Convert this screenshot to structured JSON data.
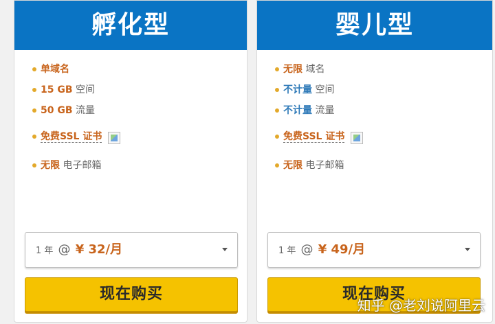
{
  "plans": [
    {
      "title": "孵化型",
      "features": {
        "domain": {
          "em": "单域名",
          "rest": ""
        },
        "space": {
          "em": "15 GB",
          "rest": "空间"
        },
        "traffic": {
          "em": "50 GB",
          "rest": "流量"
        },
        "ssl": {
          "em": "免费SSL 证书"
        },
        "email": {
          "em": "无限",
          "rest": "电子邮箱"
        }
      },
      "select": {
        "term": "1 年",
        "at": "@",
        "price": "¥ 32/月"
      },
      "buy_label": "现在购买"
    },
    {
      "title": "婴儿型",
      "features": {
        "domain": {
          "em": "无限",
          "rest": "域名"
        },
        "space": {
          "em": "不计量",
          "rest": "空间"
        },
        "traffic": {
          "em": "不计量",
          "rest": "流量"
        },
        "ssl": {
          "em": "免费SSL 证书"
        },
        "email": {
          "em": "无限",
          "rest": "电子邮箱"
        }
      },
      "select": {
        "term": "1 年",
        "at": "@",
        "price": "¥ 49/月"
      },
      "buy_label": "现在购买"
    }
  ],
  "watermark": "知乎 @老刘说阿里云",
  "colors": {
    "header": "#0a74c4",
    "accent": "#c8641c",
    "blue_accent": "#2f7ab8",
    "button": "#f5c200",
    "bullet": "#e3a92b"
  }
}
